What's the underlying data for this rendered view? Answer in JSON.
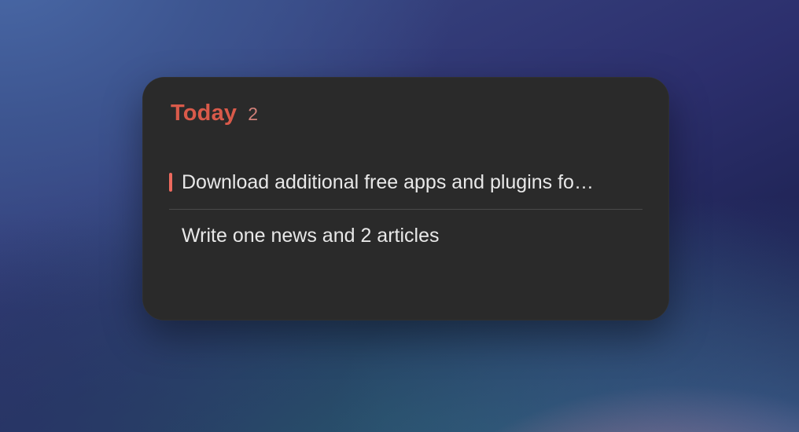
{
  "colors": {
    "accent": "#d95a4a",
    "count": "#d28079",
    "priority_bar": "#ed6a5e"
  },
  "widget": {
    "title": "Today",
    "count": "2",
    "tasks": [
      {
        "label": "Download additional free apps and plugins fo…",
        "has_priority": true
      },
      {
        "label": "Write one news and 2 articles",
        "has_priority": false
      }
    ]
  }
}
